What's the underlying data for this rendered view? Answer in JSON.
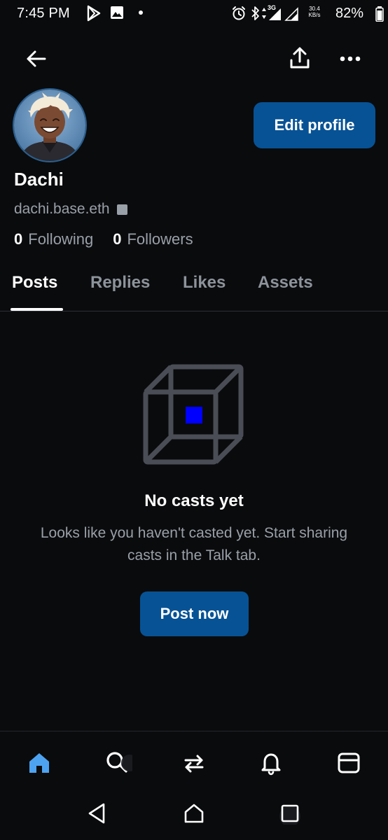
{
  "status_bar": {
    "time": "7:45 PM",
    "network_type": "3G",
    "speed_value": "30.4",
    "speed_unit": "KB/s",
    "battery_percent": "82%"
  },
  "top_bar": {
    "back_icon": "arrow-left-icon",
    "share_icon": "share-upload-icon",
    "more_icon": "more-horizontal-icon"
  },
  "profile": {
    "display_name": "Dachi",
    "handle": "dachi.base.eth",
    "following_count": "0",
    "following_label": "Following",
    "followers_count": "0",
    "followers_label": "Followers",
    "edit_profile_label": "Edit profile"
  },
  "tabs": [
    {
      "label": "Posts",
      "active": true
    },
    {
      "label": "Replies",
      "active": false
    },
    {
      "label": "Likes",
      "active": false
    },
    {
      "label": "Assets",
      "active": false
    }
  ],
  "empty_state": {
    "illustration_icon": "cube-icon",
    "title": "No casts yet",
    "description": "Looks like you haven't casted yet. Start sharing casts in the Talk tab.",
    "cta_label": "Post now"
  },
  "bottom_nav": {
    "items": [
      "home-icon",
      "search-icon",
      "swap-icon",
      "bell-icon",
      "wallet-icon"
    ],
    "active": "home-icon"
  },
  "system_nav": [
    "back-triangle-icon",
    "home-circle-icon",
    "recents-square-icon"
  ],
  "colors": {
    "background": "#0a0b0d",
    "accent_button": "#075295",
    "muted_text": "#9aa0a8",
    "active_nav": "#4ea3f1",
    "cube_core": "#0000ff"
  }
}
